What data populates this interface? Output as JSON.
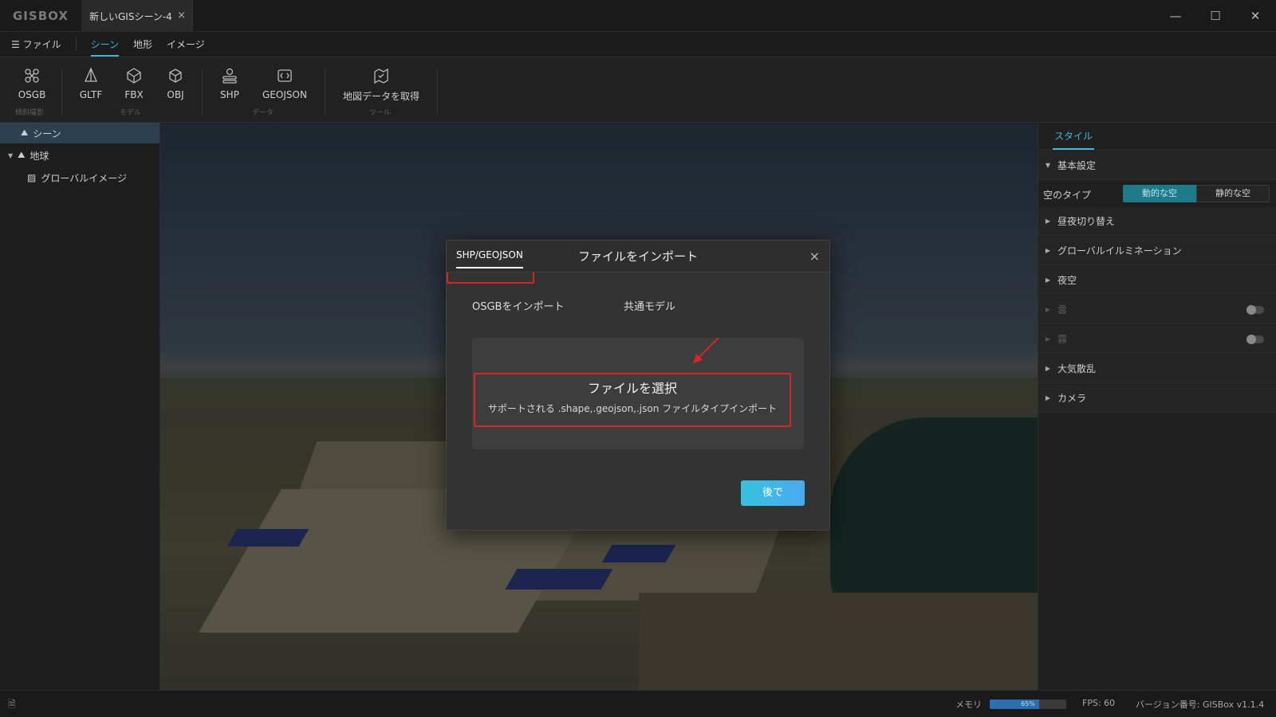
{
  "app": {
    "logo": "GISBOX",
    "tab_title": "新しいGISシーン-4",
    "tab_close": "×"
  },
  "window_controls": {
    "minimize": "—",
    "maximize": "☐",
    "close": "✕"
  },
  "menu": {
    "file": "ファイル",
    "items": [
      "シーン",
      "地形",
      "イメージ"
    ],
    "active": "シーン"
  },
  "toolbar": {
    "tools": [
      "OSGB",
      "GLTF",
      "FBX",
      "OBJ",
      "SHP",
      "GEOJSON",
      "地図データを取得"
    ],
    "groups": [
      "傾斜撮影",
      "モデル",
      "データ",
      "ツール"
    ]
  },
  "tree": {
    "items": [
      "シーン",
      "地球",
      "グローバルイメージ"
    ]
  },
  "right_panel": {
    "tab": "スタイル",
    "basic_settings": "基本設定",
    "sky_type_label": "空のタイプ",
    "sky_type_options": [
      "動的な空",
      "静的な空"
    ],
    "sky_type_selected": "動的な空",
    "sections": [
      "昼夜切り替え",
      "グローバルイルミネーション",
      "夜空",
      "雲",
      "霧",
      "大気散乱",
      "カメラ"
    ],
    "toggles": {
      "雲": false,
      "霧": false
    }
  },
  "modal": {
    "title": "ファイルをインポート",
    "close": "×",
    "tabs": [
      "OSGBをインポート",
      "共通モデル",
      "SHP/GEOJSON"
    ],
    "active_tab": "SHP/GEOJSON",
    "select_title": "ファイルを選択",
    "select_desc": "サポートされる .shape,.geojson,.json ファイルタイプインポート",
    "later_button": "後で"
  },
  "status": {
    "memory_label": "メモリ",
    "memory_text": "65%",
    "memory_percent": 65,
    "fps": "FPS: 60",
    "version": "バージョン番号: GISBox v1.1.4"
  },
  "colors": {
    "accent": "#3fb8d8",
    "highlight_red": "#d42626",
    "button_gradient_start": "#36c3e0",
    "button_gradient_end": "#4aa9f0"
  }
}
